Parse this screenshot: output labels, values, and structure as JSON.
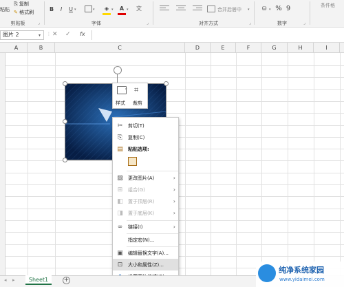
{
  "ribbon": {
    "clipboard": {
      "paste_partial": "粘贴",
      "copy": "复制",
      "format_painter": "格式刷",
      "group_label": "剪贴板"
    },
    "font": {
      "bold": "B",
      "italic": "I",
      "underline": "U",
      "group_label": "字体",
      "font_color_letter": "A",
      "highlight_letter": "A"
    },
    "alignment": {
      "merge_center": "合并后居中",
      "group_label": "对齐方式"
    },
    "number": {
      "percent": "%",
      "comma": "9",
      "group_label": "数字"
    },
    "styles": {
      "partial_label": "条件格"
    }
  },
  "formula_bar": {
    "name_box": "图片 2",
    "cancel": "✕",
    "confirm": "✓",
    "fx": "fx"
  },
  "columns": [
    "A",
    "B",
    "C",
    "D",
    "E",
    "F",
    "G",
    "H",
    "I"
  ],
  "mini_toolbar": {
    "style_label": "样式",
    "crop_label": "裁剪"
  },
  "context_menu": {
    "items": [
      {
        "label": "剪切(T)",
        "icon": "scissors-icon"
      },
      {
        "label": "复制(C)",
        "icon": "copy-icon"
      },
      {
        "label": "粘贴选项:",
        "icon": "paste-icon"
      },
      {
        "label": "更改图片(A)",
        "icon": "change-picture-icon"
      },
      {
        "label": "组合(G)",
        "icon": "group-icon"
      },
      {
        "label": "置于顶层(R)",
        "icon": "bring-front-icon"
      },
      {
        "label": "置于底层(K)",
        "icon": "send-back-icon"
      },
      {
        "label": "链接(I)",
        "icon": "link-icon"
      },
      {
        "label": "指定宏(N)...",
        "icon": ""
      },
      {
        "label": "编辑替换文字(A)...",
        "icon": "alt-text-icon"
      },
      {
        "label": "大小和属性(Z)...",
        "icon": "size-properties-icon"
      },
      {
        "label": "设置图片格式(O)...",
        "icon": "format-picture-icon"
      }
    ]
  },
  "sheet_tabs": {
    "active": "Sheet1",
    "add": "+"
  },
  "watermark": {
    "title": "纯净系统家园",
    "url": "www.yidaimei.com"
  },
  "colors": {
    "excel_green": "#217346",
    "picture_blue": "#0c2d5e",
    "highlight": "#e0e0e0"
  }
}
